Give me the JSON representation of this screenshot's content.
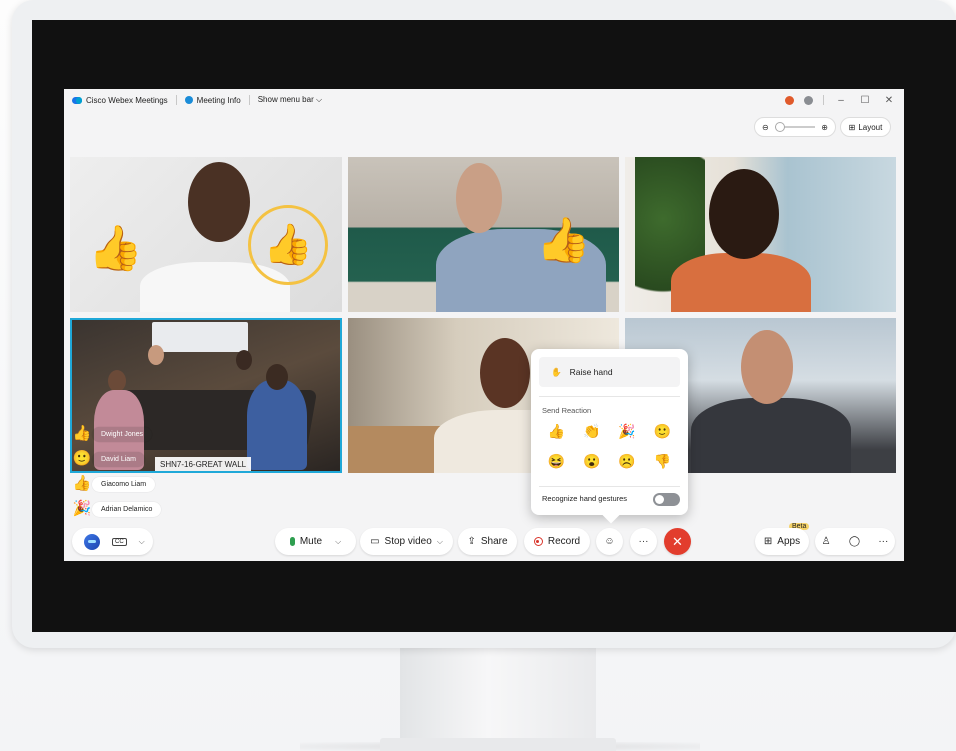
{
  "titlebar": {
    "app_name": "Cisco Webex Meetings",
    "meeting_info": "Meeting Info",
    "show_menu_bar": "Show menu bar ⌵",
    "minimize": "–",
    "maximize": "☐",
    "close": "✕"
  },
  "view": {
    "zoom_out": "⊖",
    "zoom_in": "⊕",
    "layout_label": "Layout"
  },
  "room_label": "SHN7-16-GREAT WALL",
  "participants_reactions": [
    {
      "emoji": "👍",
      "name": "Dwight Jones"
    },
    {
      "emoji": "🙂",
      "name": "David Liam"
    },
    {
      "emoji": "👍",
      "name": "Giacomo Liam"
    },
    {
      "emoji": "🎉",
      "name": "Adrian Delamico"
    }
  ],
  "reaction_popup": {
    "raise_hand": "Raise hand",
    "send_reaction_title": "Send Reaction",
    "emojis": [
      "👍",
      "👏",
      "🎉",
      "🙂",
      "😆",
      "😮",
      "☹️",
      "👎"
    ],
    "recognize_gestures": "Recognize hand gestures",
    "recognize_gestures_on": false
  },
  "toolbar": {
    "mute_label": "Mute",
    "stop_video_label": "Stop video",
    "share_label": "Share",
    "record_label": "Record",
    "reactions_icon": "☺",
    "more": "···",
    "end_call": "✕",
    "apps_label": "Apps",
    "apps_badge": "Beta",
    "participants_icon": "♙",
    "chat_icon": "◯",
    "more_right": "···",
    "cc_label": "CC",
    "chevron": "⌵"
  },
  "colors": {
    "accent": "#1fa8d8",
    "end_call": "#e23d2d",
    "mic_green": "#2e9e4f"
  }
}
